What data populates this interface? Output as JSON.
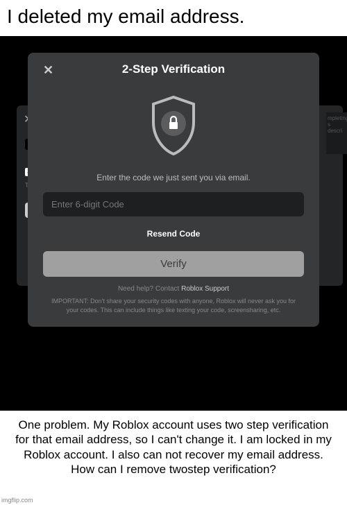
{
  "meme": {
    "top": "I deleted my email address.",
    "bottom": "One problem. My Roblox account uses two step verification for that email address, so I can't change it. I am locked in my Roblox account. I also can not recover my email address. How can I remove twostep verification?",
    "watermark": "imgflip.com"
  },
  "back": {
    "the_text": "The"
  },
  "modal": {
    "title": "2-Step Verification",
    "instruction": "Enter the code we just sent you via email.",
    "code_placeholder": "Enter 6-digit Code",
    "resend_label": "Resend Code",
    "verify_label": "Verify",
    "help_prefix": "Need help? Contact ",
    "help_link": "Roblox Support",
    "warning": "IMPORTANT: Don't share your security codes with anyone, Roblox will never ask you for your codes. This can include things like texting your code, screensharing, etc."
  }
}
